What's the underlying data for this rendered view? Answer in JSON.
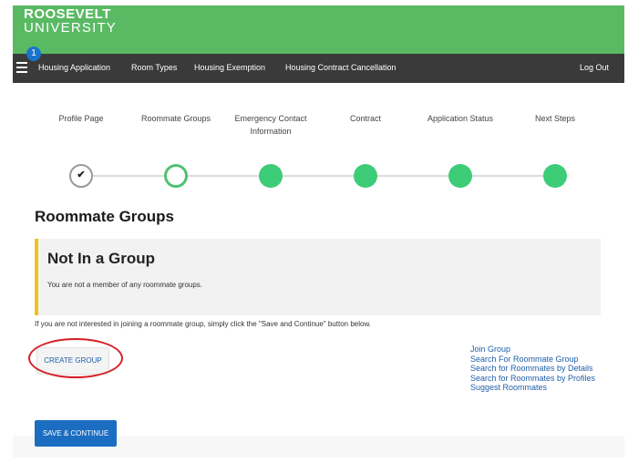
{
  "header": {
    "brand_line1": "ROOSEVELT",
    "brand_line2": "UNIVERSITY",
    "notification_count": "1"
  },
  "nav": {
    "items": [
      "Housing Application",
      "Room Types",
      "Housing Exemption",
      "Housing Contract Cancellation"
    ],
    "logout": "Log Out"
  },
  "steps": [
    {
      "label": "Profile Page",
      "status": "done"
    },
    {
      "label": "Roommate Groups",
      "status": "current"
    },
    {
      "label": "Emergency Contact Information",
      "status": "todo"
    },
    {
      "label": "Contract",
      "status": "todo"
    },
    {
      "label": "Application Status",
      "status": "todo"
    },
    {
      "label": "Next Steps",
      "status": "todo"
    }
  ],
  "page_title": "Roommate Groups",
  "notice": {
    "title": "Not In a Group",
    "description": "You are not a member of any roommate groups."
  },
  "help_text": "If you are not interested in joining a roommate group, simply click the \"Save and Continue\" button below.",
  "create_group_label": "CREATE GROUP",
  "side_links": [
    "Join Group",
    "Search For Roommate Group",
    "Search for Roommates by Details",
    "Search for Roommates by Profiles",
    "Suggest Roommates"
  ],
  "save_label": "SAVE & CONTINUE",
  "colors": {
    "header_green": "#59ba63",
    "nav_dark": "#3a3a3a",
    "step_green": "#3dcc78",
    "accent_yellow": "#f0c419",
    "link_blue": "#1f5fa8",
    "primary_blue": "#1b6dc1",
    "highlight_red": "#d61f26"
  }
}
